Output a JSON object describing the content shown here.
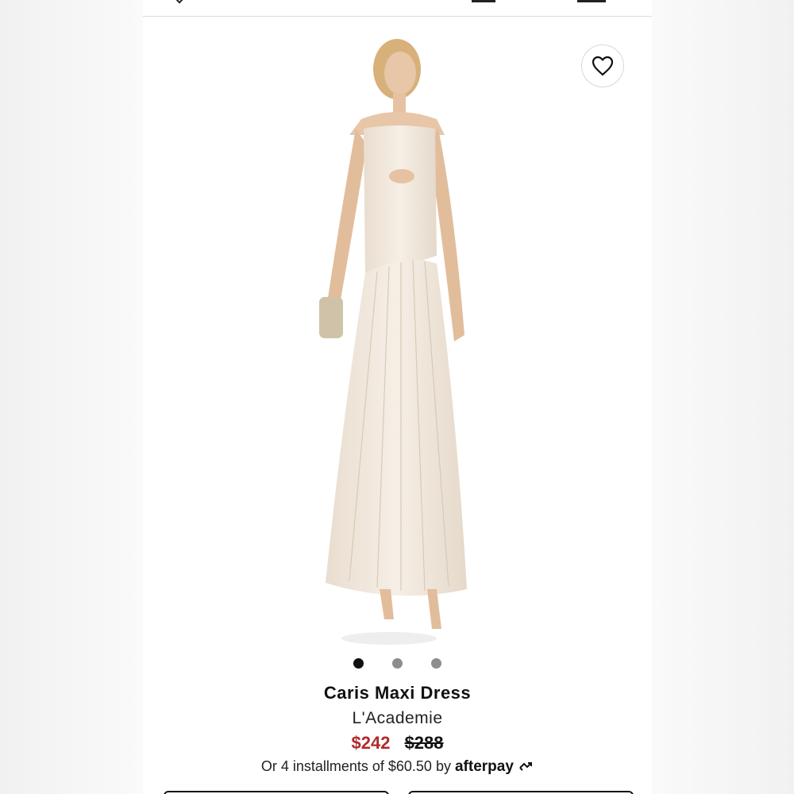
{
  "product": {
    "title": "Caris Maxi Dress",
    "brand": "L'Academie",
    "price_sale": "$242",
    "price_original": "$288",
    "installments_text": "Or 4 installments of $60.50 by",
    "afterpay_label": "afterpay"
  },
  "gallery": {
    "total_images": 3,
    "active_index": 0
  },
  "icons": {
    "wishlist": "heart-icon",
    "back": "chevron-left-icon",
    "afterpay": "afterpay-arrows-icon"
  },
  "colors": {
    "sale_price": "#b12a2a",
    "text": "#111111",
    "dress": "#efe6da"
  }
}
